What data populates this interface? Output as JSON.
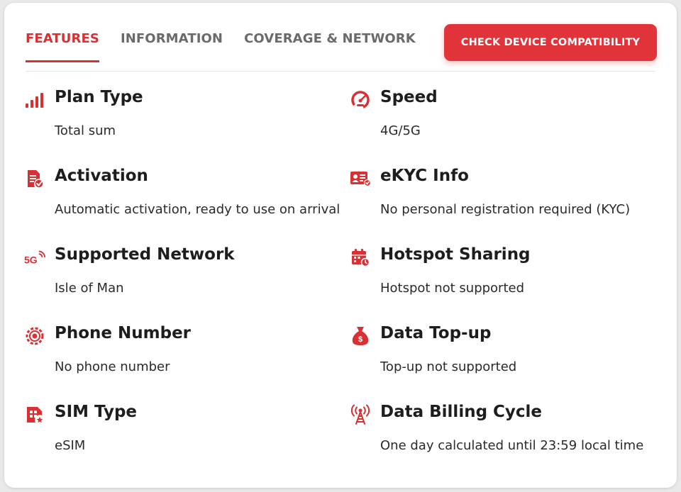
{
  "tabs": [
    {
      "label": "FEATURES",
      "active": true
    },
    {
      "label": "INFORMATION",
      "active": false
    },
    {
      "label": "COVERAGE & NETWORK",
      "active": false
    }
  ],
  "cta": {
    "label": "CHECK DEVICE COMPATIBILITY"
  },
  "colors": {
    "accent": "#d93034",
    "button": "#e0333a"
  },
  "features": {
    "plan_type": {
      "icon": "signal-bars-icon",
      "title": "Plan Type",
      "value": "Total sum"
    },
    "speed": {
      "icon": "speedometer-icon",
      "title": "Speed",
      "value": "4G/5G"
    },
    "activation": {
      "icon": "document-check-icon",
      "title": "Activation",
      "value": "Automatic activation, ready to use on arrival"
    },
    "ekyc": {
      "icon": "id-card-icon",
      "title": "eKYC Info",
      "value": "No personal registration required (KYC)"
    },
    "network": {
      "icon": "5g-icon",
      "badge": "5G",
      "title": "Supported Network",
      "value": "Isle of Man"
    },
    "hotspot": {
      "icon": "calendar-icon",
      "title": "Hotspot Sharing",
      "value": "Hotspot not supported"
    },
    "phone": {
      "icon": "gear-phone-icon",
      "title": "Phone Number",
      "value": "No phone number"
    },
    "topup": {
      "icon": "money-bag-icon",
      "title": "Data Top-up",
      "value": "Top-up not supported"
    },
    "sim": {
      "icon": "sim-card-icon",
      "title": "SIM Type",
      "value": "eSIM"
    },
    "billing": {
      "icon": "antenna-tower-icon",
      "title": "Data Billing Cycle",
      "value": "One day calculated until 23:59 local time"
    }
  }
}
